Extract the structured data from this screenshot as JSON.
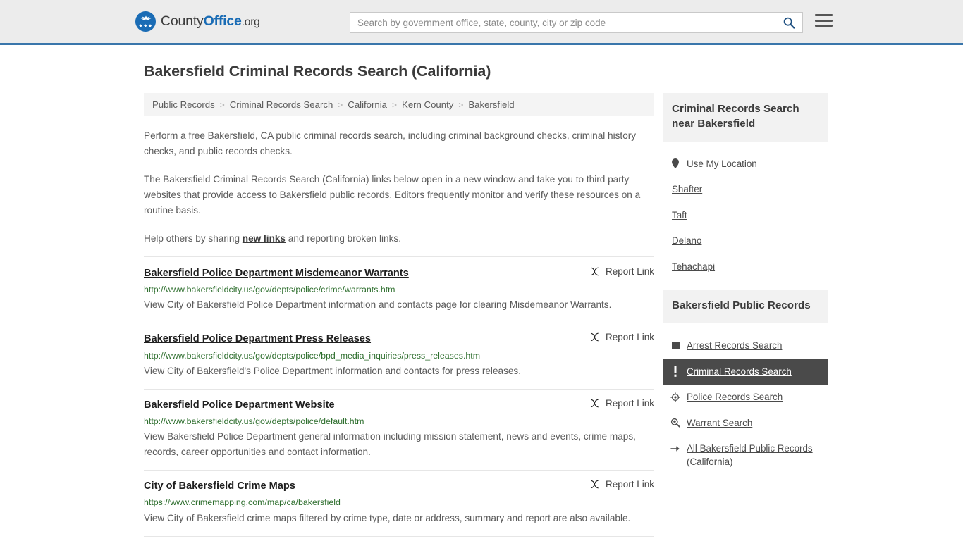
{
  "header": {
    "logo": {
      "part1": "County",
      "part2": "Office",
      "part3": ".org",
      "stars": "★★★"
    },
    "search": {
      "placeholder": "Search by government office, state, county, city or zip code",
      "value": ""
    },
    "menu_label": "menu"
  },
  "page": {
    "title": "Bakersfield Criminal Records Search (California)"
  },
  "breadcrumb": {
    "separator": ">",
    "items": [
      {
        "label": "Public Records"
      },
      {
        "label": "Criminal Records Search"
      },
      {
        "label": "California"
      },
      {
        "label": "Kern County"
      },
      {
        "label": "Bakersfield"
      }
    ]
  },
  "intro": {
    "p1": "Perform a free Bakersfield, CA public criminal records search, including criminal background checks, criminal history checks, and public records checks.",
    "p2": "The Bakersfield Criminal Records Search (California) links below open in a new window and take you to third party websites that provide access to Bakersfield public records. Editors frequently monitor and verify these resources on a routine basis.",
    "p3_before": "Help others by sharing ",
    "p3_link": "new links",
    "p3_after": " and reporting broken links."
  },
  "results": {
    "report_label": "Report Link",
    "items": [
      {
        "title": "Bakersfield Police Department Misdemeanor Warrants",
        "url": "http://www.bakersfieldcity.us/gov/depts/police/crime/warrants.htm",
        "description": "View City of Bakersfield Police Department information and contacts page for clearing Misdemeanor Warrants."
      },
      {
        "title": "Bakersfield Police Department Press Releases",
        "url": "http://www.bakersfieldcity.us/gov/depts/police/bpd_media_inquiries/press_releases.htm",
        "description": "View City of Bakersfield's Police Department information and contacts for press releases."
      },
      {
        "title": "Bakersfield Police Department Website",
        "url": "http://www.bakersfieldcity.us/gov/depts/police/default.htm",
        "description": "View Bakersfield Police Department general information including mission statement, news and events, crime maps, records, career opportunities and contact information."
      },
      {
        "title": "City of Bakersfield Crime Maps",
        "url": "https://www.crimemapping.com/map/ca/bakersfield",
        "description": "View City of Bakersfield crime maps filtered by crime type, date or address, summary and report are also available."
      }
    ]
  },
  "sidebar": {
    "nearby": {
      "heading": "Criminal Records Search near Bakersfield",
      "items": [
        {
          "label": "Use My Location",
          "icon": "map-pin-icon"
        },
        {
          "label": "Shafter",
          "icon": ""
        },
        {
          "label": "Taft",
          "icon": ""
        },
        {
          "label": "Delano",
          "icon": ""
        },
        {
          "label": "Tehachapi",
          "icon": ""
        }
      ]
    },
    "public_records": {
      "heading": "Bakersfield Public Records",
      "items": [
        {
          "label": "Arrest Records Search",
          "icon": "square-icon",
          "active": false
        },
        {
          "label": "Criminal Records Search",
          "icon": "exclamation-icon",
          "active": true
        },
        {
          "label": "Police Records Search",
          "icon": "target-icon",
          "active": false
        },
        {
          "label": "Warrant Search",
          "icon": "magnifier-plus-icon",
          "active": false
        },
        {
          "label": "All Bakersfield Public Records (California)",
          "icon": "arrow-right-icon",
          "active": false
        }
      ]
    }
  },
  "colors": {
    "brand_blue": "#1a6cb5",
    "header_border": "#3a76ab",
    "header_bg": "#ececec",
    "url_green": "#2d6e2d",
    "active_bg": "#4a4a4a",
    "panel_bg": "#f2f2f2"
  }
}
